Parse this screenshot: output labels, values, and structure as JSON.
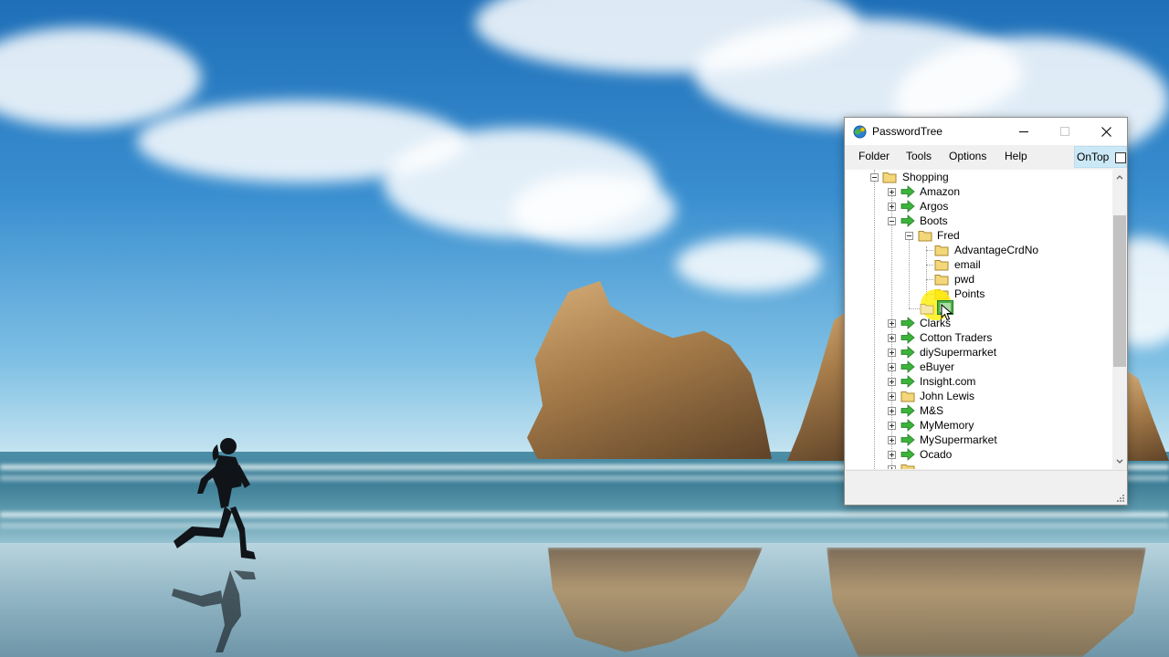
{
  "window": {
    "title": "PasswordTree",
    "app_icon": "globe-key-icon",
    "controls": {
      "minimize": "minimize-icon",
      "maximize": "maximize-icon",
      "close": "close-icon"
    }
  },
  "menu": {
    "items": [
      {
        "label": "Folder"
      },
      {
        "label": "Tools"
      },
      {
        "label": "Options"
      },
      {
        "label": "Help"
      }
    ],
    "ontop": {
      "label": "OnTop",
      "checked": false
    }
  },
  "tree": {
    "nodes": [
      {
        "label": "Shopping",
        "icon": "folder-icon",
        "expanded": true
      },
      {
        "label": "Amazon",
        "icon": "green-arrow-icon",
        "expanded": false
      },
      {
        "label": "Argos",
        "icon": "green-arrow-icon",
        "expanded": false
      },
      {
        "label": "Boots",
        "icon": "green-arrow-icon",
        "expanded": true
      },
      {
        "label": "Fred",
        "icon": "folder-icon",
        "expanded": true
      },
      {
        "label": "AdvantageCrdNo",
        "icon": "folder-icon"
      },
      {
        "label": "email",
        "icon": "folder-icon"
      },
      {
        "label": "pwd",
        "icon": "folder-icon"
      },
      {
        "label": "Points",
        "icon": "folder-icon"
      },
      {
        "label": "Clarks",
        "icon": "green-arrow-icon",
        "expanded": false
      },
      {
        "label": "Cotton Traders",
        "icon": "green-arrow-icon",
        "expanded": false
      },
      {
        "label": "diySupermarket",
        "icon": "green-arrow-icon",
        "expanded": false
      },
      {
        "label": "eBuyer",
        "icon": "green-arrow-icon",
        "expanded": false
      },
      {
        "label": "Insight.com",
        "icon": "green-arrow-icon",
        "expanded": false
      },
      {
        "label": "John Lewis",
        "icon": "folder-icon",
        "expanded": false
      },
      {
        "label": "M&S",
        "icon": "green-arrow-icon",
        "expanded": false
      },
      {
        "label": "MyMemory",
        "icon": "green-arrow-icon",
        "expanded": false
      },
      {
        "label": "MySupermarket",
        "icon": "green-arrow-icon",
        "expanded": false
      },
      {
        "label": "Ocado",
        "icon": "green-arrow-icon",
        "expanded": false
      }
    ]
  },
  "colors": {
    "arrow_green": "#3bb33b",
    "folder_yellow": "#f3d77a",
    "ontop_bg": "#cbe8f6"
  }
}
